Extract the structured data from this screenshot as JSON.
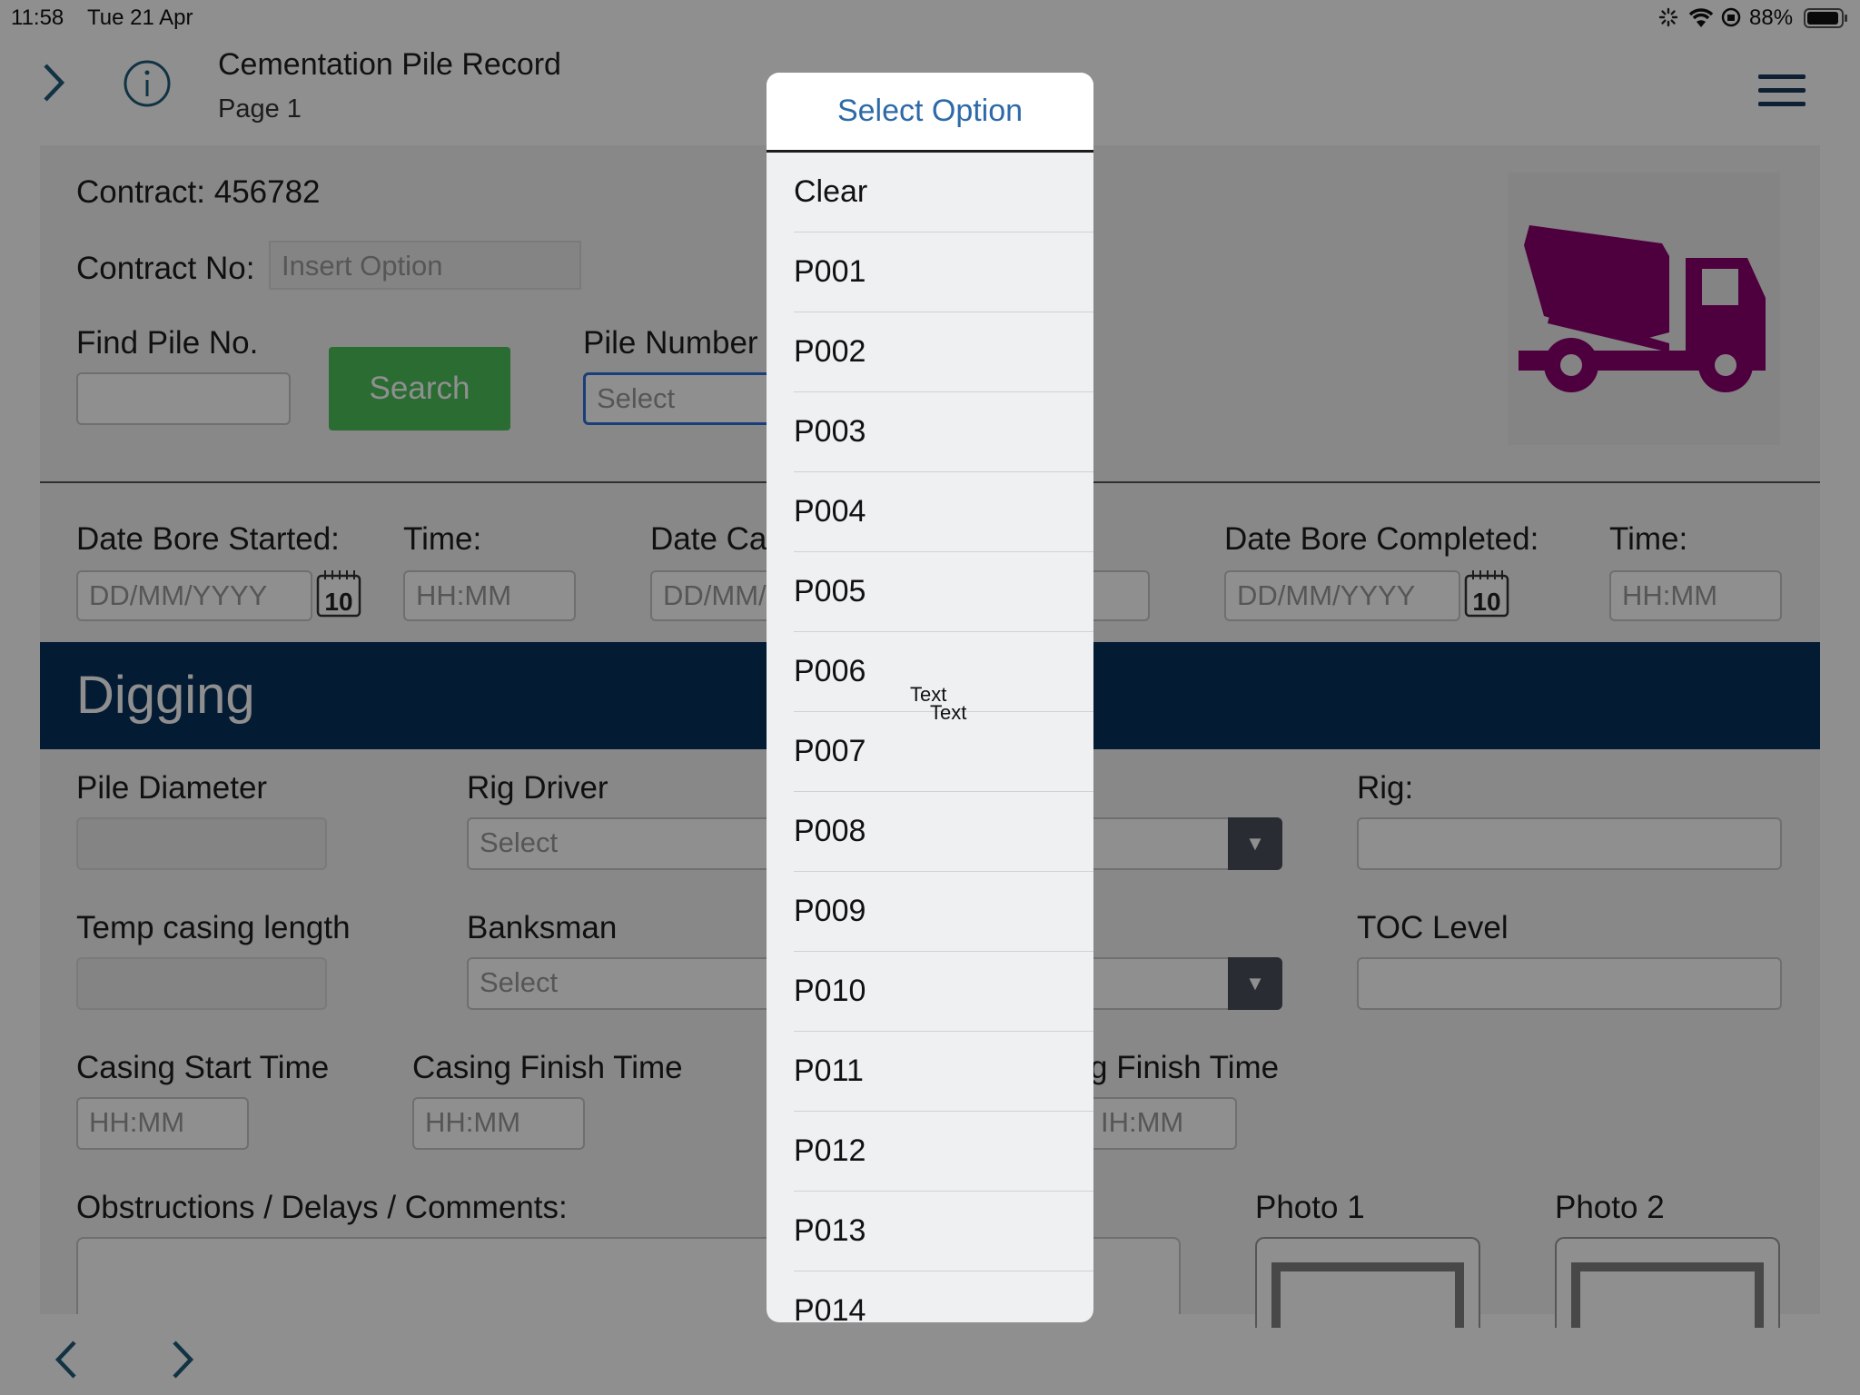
{
  "status_bar": {
    "time": "11:58",
    "date": "Tue 21 Apr",
    "battery": "88%"
  },
  "header": {
    "title": "Cementation Pile Record",
    "subtitle": "Page 1"
  },
  "contract": {
    "contract_label": "Contract: 456782",
    "contract_no_label": "Contract No:",
    "contract_no_placeholder": "Insert Option",
    "find_pile_label": "Find Pile No.",
    "search_label": "Search",
    "pile_number_label": "Pile Number",
    "pile_number_placeholder": "Select"
  },
  "dates": {
    "bore_started_label": "Date Bore Started:",
    "bore_started_placeholder": "DD/MM/YYYY",
    "time1_label": "Time:",
    "time1_placeholder": "HH:MM",
    "date_ca_label": "Date Ca",
    "date_ca_placeholder": "DD/MM/",
    "bore_completed_label": "Date Bore Completed:",
    "bore_completed_placeholder": "DD/MM/YYYY",
    "time2_label": "Time:",
    "time2_placeholder": "HH:MM",
    "calendar_day": "10"
  },
  "digging": {
    "section_title": "Digging",
    "pile_diameter_label": "Pile Diameter",
    "rig_driver_label": "Rig Driver",
    "rig_driver_placeholder": "Select",
    "rig_label": "Rig:",
    "temp_casing_label": "Temp casing length",
    "banksman_label": "Banksman",
    "banksman_placeholder": "Select",
    "toc_label": "TOC Level",
    "casing_start_label": "Casing Start Time",
    "casing_start_placeholder": "HH:MM",
    "casing_finish_label": "Casing Finish Time",
    "casing_finish_placeholder": "HH:MM",
    "g_finish_label": "g Finish Time",
    "g_finish_placeholder": "IH:MM",
    "comments_label": "Obstructions / Delays / Comments:",
    "photo1_label": "Photo 1",
    "photo2_label": "Photo 2"
  },
  "popup": {
    "title": "Select Option",
    "options": [
      "Clear",
      "P001",
      "P002",
      "P003",
      "P004",
      "P005",
      "P006",
      "P007",
      "P008",
      "P009",
      "P010",
      "P011",
      "P012",
      "P013",
      "P014"
    ],
    "floating_text_1": "Text",
    "floating_text_2": "Text"
  },
  "colors": {
    "accent_blue": "#08305e",
    "search_green": "#4cc15a",
    "truck_magenta": "#8b006f",
    "popup_title": "#2e6aa8"
  },
  "icons": [
    "chevron-right-icon",
    "info-icon",
    "hamburger-menu-icon",
    "calendar-icon",
    "dropdown-arrow-icon",
    "truck-icon",
    "chevron-left-icon"
  ]
}
